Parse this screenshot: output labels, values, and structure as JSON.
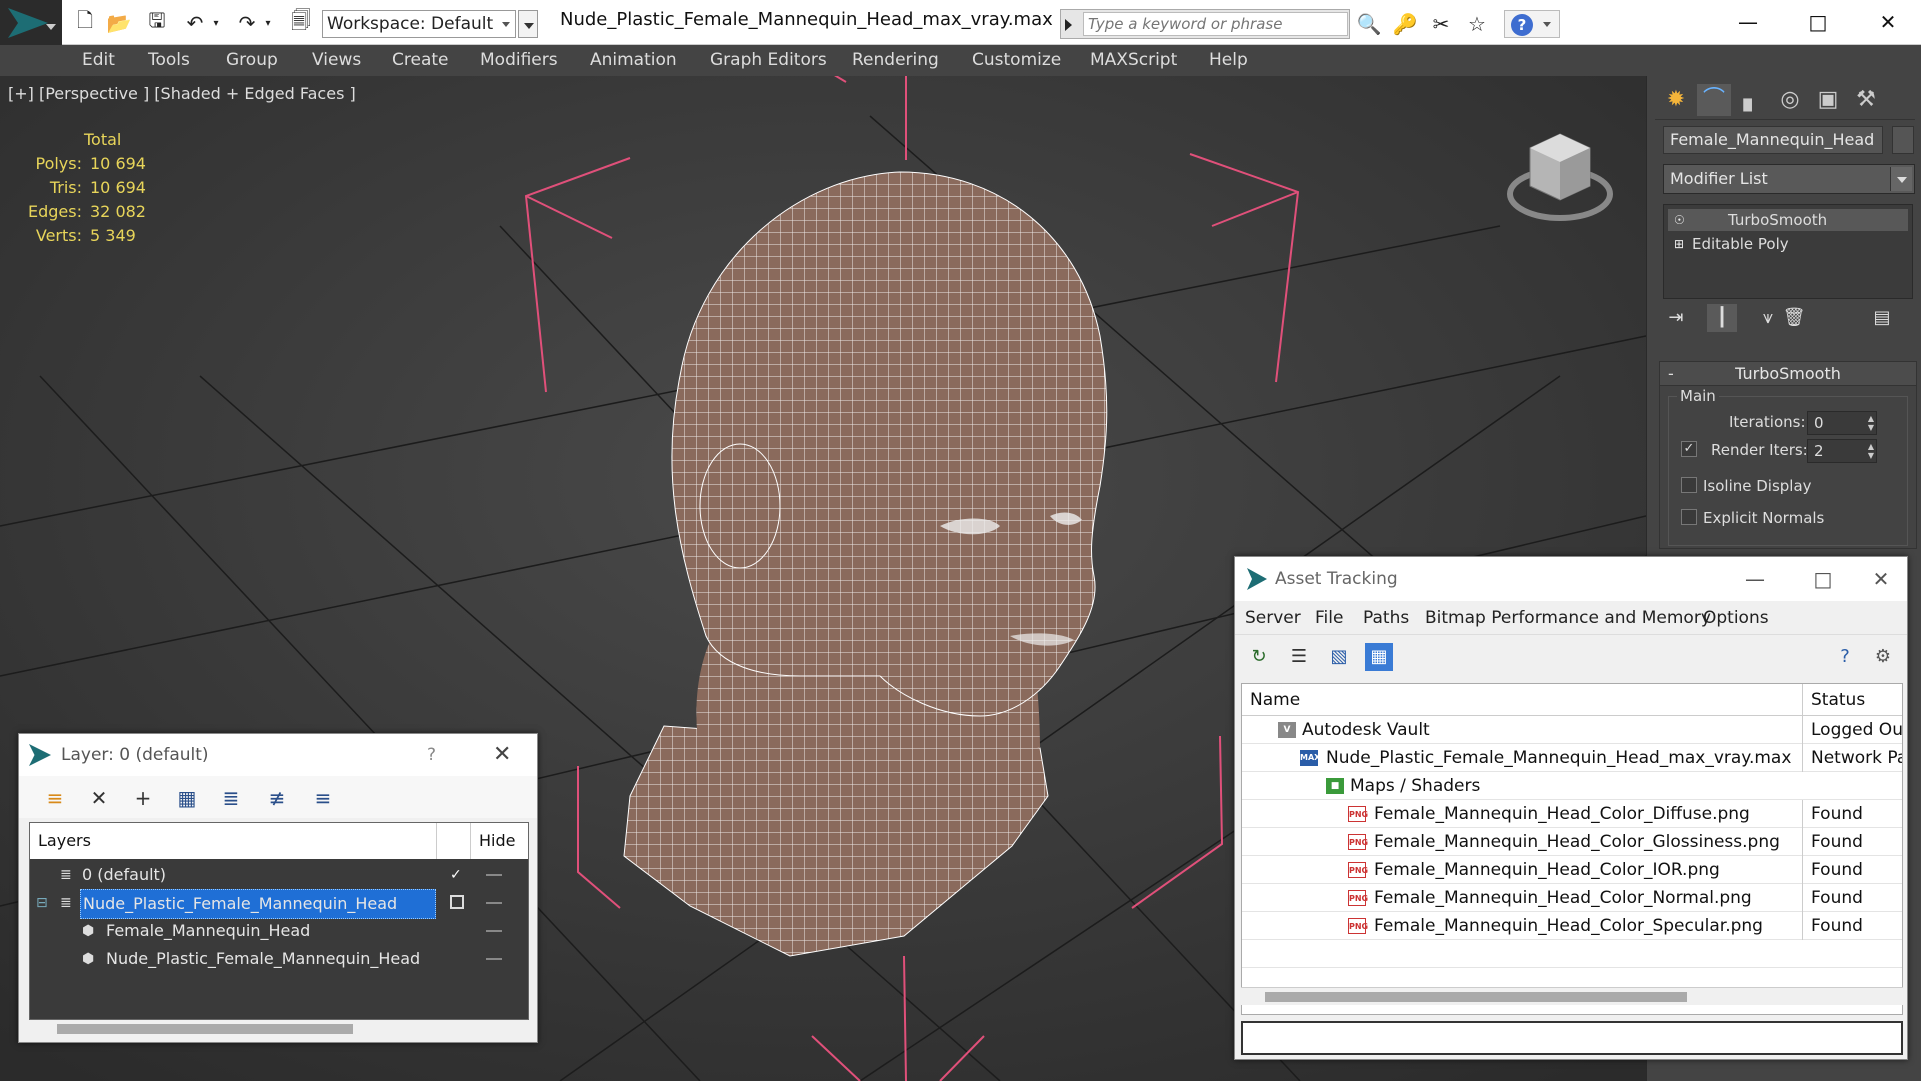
{
  "window": {
    "document_title": "Nude_Plastic_Female_Mannequin_Head_max_vray.max",
    "workspace_label": "Workspace: Default",
    "search_placeholder": "Type a keyword or phrase"
  },
  "menu": [
    "Edit",
    "Tools",
    "Group",
    "Views",
    "Create",
    "Modifiers",
    "Animation",
    "Graph Editors",
    "Rendering",
    "Customize",
    "MAXScript",
    "Help"
  ],
  "viewport": {
    "label": "[+] [Perspective ] [Shaded + Edged Faces ]",
    "stats_header": "Total",
    "stats": [
      {
        "label": "Polys:",
        "value": "10 694"
      },
      {
        "label": "Tris:",
        "value": "10 694"
      },
      {
        "label": "Edges:",
        "value": "32 082"
      },
      {
        "label": "Verts:",
        "value": "5 349"
      }
    ]
  },
  "command_panel": {
    "object_name": "Female_Mannequin_Head",
    "modifier_list": "Modifier List",
    "stack": [
      "TurboSmooth",
      "Editable Poly"
    ],
    "turbosmooth": {
      "title": "TurboSmooth",
      "group": "Main",
      "iterations_label": "Iterations:",
      "iterations_value": "0",
      "render_iters_label": "Render Iters:",
      "render_iters_value": "2",
      "render_iters_checked": true,
      "isoline_label": "Isoline Display",
      "explicit_normals_label": "Explicit Normals"
    }
  },
  "layer_window": {
    "title": "Layer: 0 (default)",
    "help": "?",
    "columns": {
      "layers": "Layers",
      "hide": "Hide"
    },
    "rows": [
      {
        "label": "0 (default)",
        "selected": false,
        "indent": 1,
        "active": true
      },
      {
        "label": "Nude_Plastic_Female_Mannequin_Head",
        "selected": true,
        "indent": 1,
        "active": false
      },
      {
        "label": "Female_Mannequin_Head",
        "selected": false,
        "indent": 2,
        "active": false
      },
      {
        "label": "Nude_Plastic_Female_Mannequin_Head",
        "selected": false,
        "indent": 2,
        "active": false
      }
    ]
  },
  "asset_window": {
    "title": "Asset Tracking",
    "menu": [
      "Server",
      "File",
      "Paths",
      "Bitmap Performance and Memory",
      "Options"
    ],
    "columns": {
      "name": "Name",
      "status": "Status"
    },
    "rows": [
      {
        "name": "Autodesk Vault",
        "status": "Logged Ou",
        "icon": "vault",
        "indent": 1
      },
      {
        "name": "Nude_Plastic_Female_Mannequin_Head_max_vray.max",
        "status": "Network Pa",
        "icon": "max",
        "indent": 2
      },
      {
        "name": "Maps / Shaders",
        "status": "",
        "icon": "maps",
        "indent": 3
      },
      {
        "name": "Female_Mannequin_Head_Color_Diffuse.png",
        "status": "Found",
        "icon": "png",
        "indent": 4
      },
      {
        "name": "Female_Mannequin_Head_Color_Glossiness.png",
        "status": "Found",
        "icon": "png",
        "indent": 4
      },
      {
        "name": "Female_Mannequin_Head_Color_IOR.png",
        "status": "Found",
        "icon": "png",
        "indent": 4
      },
      {
        "name": "Female_Mannequin_Head_Color_Normal.png",
        "status": "Found",
        "icon": "png",
        "indent": 4
      },
      {
        "name": "Female_Mannequin_Head_Color_Specular.png",
        "status": "Found",
        "icon": "png",
        "indent": 4
      }
    ]
  },
  "colors": {
    "stats": "#e8d55a",
    "selection": "#3a7bd5",
    "bounding_box": "#e0507a",
    "mesh_fill": "#8a6a5c",
    "wire": "#ffffff"
  }
}
